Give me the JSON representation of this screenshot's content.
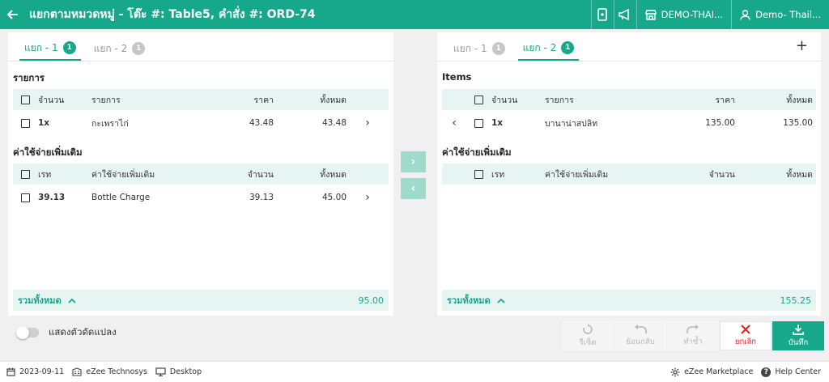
{
  "header": {
    "title": "แยกตามหมวดหมู่ - โต๊ะ #: Table5, คำสั่ง #: ORD-74",
    "outlet": "DEMO-THAI...",
    "user": "Demo- Thail..."
  },
  "left": {
    "tabs": [
      {
        "label": "แยก - 1",
        "count": "1"
      },
      {
        "label": "แยก - 2",
        "count": "1"
      }
    ],
    "items_title": "รายการ",
    "items_headers": {
      "qty": "จำนวน",
      "name": "รายการ",
      "price": "ราคา",
      "total": "ทั้งหมด"
    },
    "items": [
      {
        "qty": "1x",
        "name": "กะเพราไก่",
        "price": "43.48",
        "total": "43.48"
      }
    ],
    "extra_title": "ค่าใช้จ่ายเพิ่มเติม",
    "extra_headers": {
      "rate": "เรท",
      "name": "ค่าใช้จ่ายเพิ่มเติม",
      "qty": "จำนวน",
      "total": "ทั้งหมด"
    },
    "extras": [
      {
        "rate": "39.13",
        "name": "Bottle Charge",
        "qty": "39.13",
        "total": "45.00"
      }
    ],
    "total_label": "รวมทั้งหมด",
    "total_value": "95.00"
  },
  "right": {
    "tabs": [
      {
        "label": "แยก - 1",
        "count": "1"
      },
      {
        "label": "แยก - 2",
        "count": "1"
      }
    ],
    "items_title": "Items",
    "items_headers": {
      "qty": "จำนวน",
      "name": "รายการ",
      "price": "ราคา",
      "total": "ทั้งหมด"
    },
    "items": [
      {
        "qty": "1x",
        "name": "บานาน่าสปลิท",
        "price": "135.00",
        "total": "135.00"
      }
    ],
    "extra_title": "ค่าใช้จ่ายเพิ่มเติม",
    "extra_headers": {
      "rate": "เรท",
      "name": "ค่าใช้จ่ายเพิ่มเติม",
      "qty": "จำนวน",
      "total": "ทั้งหมด"
    },
    "total_label": "รวมทั้งหมด",
    "total_value": "155.25"
  },
  "toggle_label": "แสดงตัวดัดแปลง",
  "actions": {
    "reset": "รีเซ็ต",
    "undo": "ย้อนกลับ",
    "redo": "ทำซ้ำ",
    "cancel": "ยกเลิก",
    "save": "บันทึก"
  },
  "status": {
    "date": "2023-09-11",
    "company": "eZee Technosys",
    "device": "Desktop",
    "marketplace": "eZee Marketplace",
    "help": "Help Center"
  },
  "colors": {
    "accent": "#17a88c",
    "header_row": "#e7f5f2",
    "cancel": "#e02020"
  }
}
